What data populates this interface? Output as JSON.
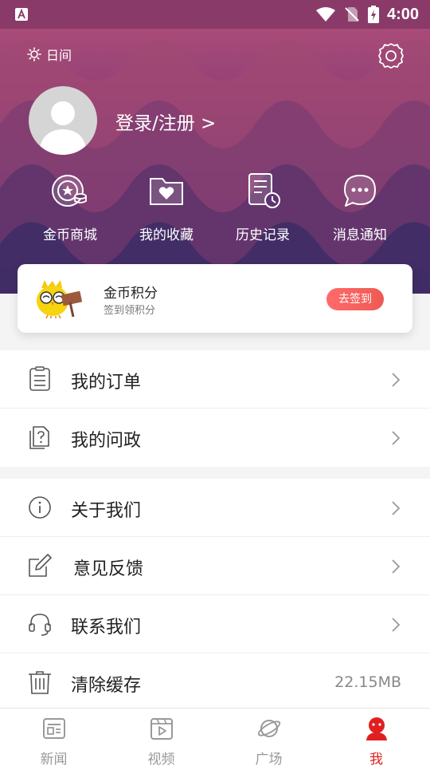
{
  "status_bar": {
    "time": "4:00"
  },
  "header": {
    "day_mode_label": "日间",
    "login_label": "登录/注册 >",
    "quick_actions": [
      {
        "label": "金币商城",
        "icon": "coin-mall-icon"
      },
      {
        "label": "我的收藏",
        "icon": "favorites-folder-icon"
      },
      {
        "label": "历史记录",
        "icon": "history-icon"
      },
      {
        "label": "消息通知",
        "icon": "message-icon"
      }
    ]
  },
  "coin_card": {
    "title": "金币积分",
    "subtitle": "签到领积分",
    "sign_button": "去签到"
  },
  "menu": {
    "group1": [
      {
        "label": "我的订单",
        "icon": "order-list-icon"
      },
      {
        "label": "我的问政",
        "icon": "question-doc-icon"
      }
    ],
    "group2": [
      {
        "label": "关于我们",
        "icon": "info-icon"
      },
      {
        "label": "意见反馈",
        "icon": "edit-icon"
      },
      {
        "label": "联系我们",
        "icon": "headset-icon"
      },
      {
        "label": "清除缓存",
        "icon": "trash-icon",
        "value": "22.15MB"
      }
    ]
  },
  "tabbar": [
    {
      "label": "新闻",
      "icon": "news-icon"
    },
    {
      "label": "视频",
      "icon": "video-icon"
    },
    {
      "label": "广场",
      "icon": "planet-icon"
    },
    {
      "label": "我",
      "icon": "me-icon",
      "active": true
    }
  ],
  "colors": {
    "accent": "#e02020",
    "sign_button": "#ee5a52"
  }
}
